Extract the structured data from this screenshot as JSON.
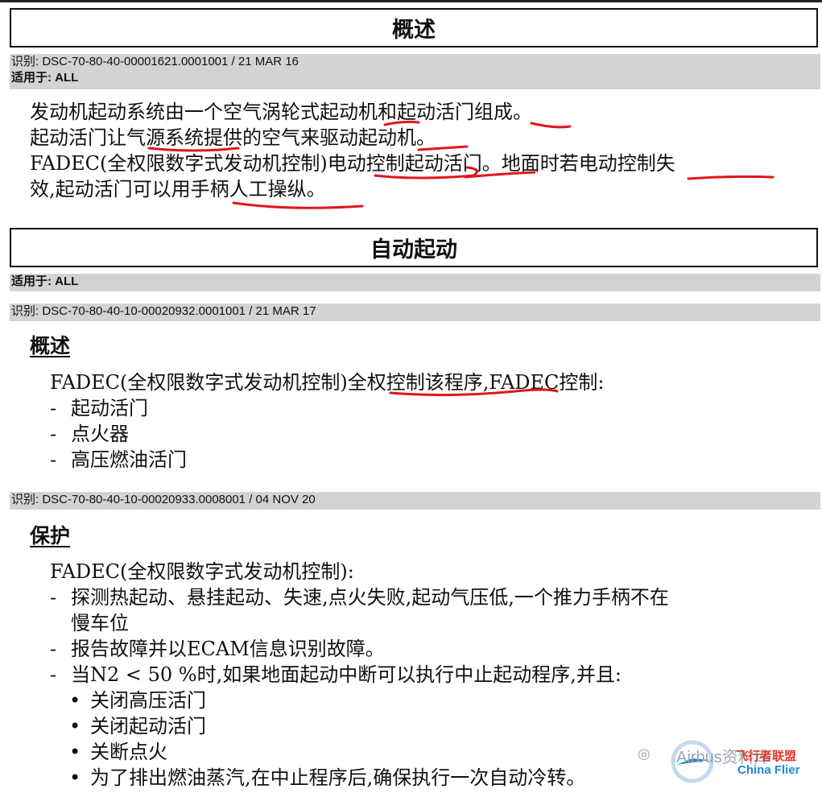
{
  "section1": {
    "title": "概述",
    "id_label": "识别: ",
    "id_value": "DSC-70-80-40-00001621.0001001 / 21 MAR 16",
    "applies_label": "适用于: ",
    "applies_value": "ALL",
    "lines": [
      "发动机起动系统由一个空气涡轮式起动机和起动活门组成。",
      "起动活门让气源系统提供的空气来驱动起动机。",
      "FADEC(全权限数字式发动机控制)电动控制起动活门。地面时若电动控制失",
      "效,起动活门可以用手柄人工操纵。"
    ]
  },
  "section2": {
    "title": "自动起动",
    "applies_label": "适用于: ",
    "applies_value": "ALL",
    "block1": {
      "id_label": "识别: ",
      "id_value": "DSC-70-80-40-10-00020932.0001001 / 21 MAR 17",
      "heading": "概述",
      "intro": "FADEC(全权限数字式发动机控制)全权控制该程序,FADEC控制:",
      "items": [
        "起动活门",
        "点火器",
        "高压燃油活门"
      ]
    },
    "block2": {
      "id_label": "识别: ",
      "id_value": "DSC-70-80-40-10-00020933.0008001 / 04 NOV 20",
      "heading": "保护",
      "intro": "FADEC(全权限数字式发动机控制):",
      "items": [
        "探测热起动、悬挂起动、失速,点火失败,起动气压低,一个推力手柄不在",
        "慢车位",
        "报告故障并以ECAM信息识别故障。",
        "当N2 < 50 %时,如果地面起动中断可以执行中止起动程序,并且:"
      ],
      "subitems": [
        "关闭高压活门",
        "关闭起动活门",
        "关断点火",
        "为了排出燃油蒸汽,在中止程序后,确保执行一次自动冷转。"
      ]
    }
  },
  "list_dash": "-",
  "list_bullet": "•",
  "watermark": {
    "text1": "Airbus资料库",
    "text2": "飞行者联盟",
    "text3": "China Flier",
    "accent_red": "#e2382c",
    "accent_blue": "#1e88d2"
  },
  "annotation_color": "#e0161b"
}
